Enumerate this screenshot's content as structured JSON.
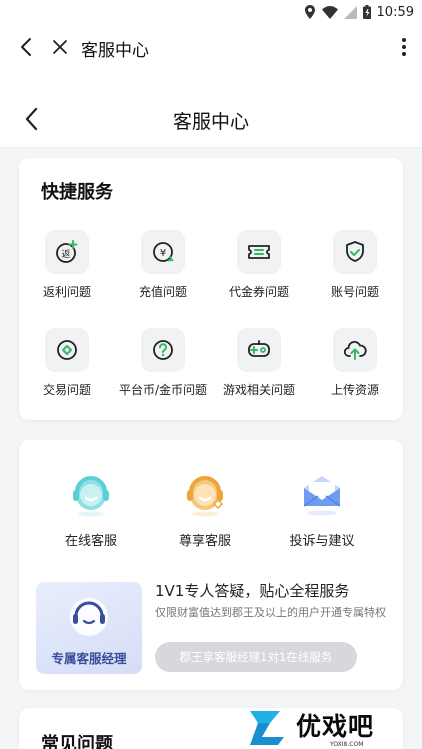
{
  "status_bar": {
    "time": "10:59",
    "icons": [
      "location-icon",
      "wifi-icon",
      "signal-icon",
      "battery-icon"
    ]
  },
  "web_bar": {
    "title": "客服中心"
  },
  "page_header": {
    "title": "客服中心"
  },
  "quick_services": {
    "title": "快捷服务",
    "items": [
      {
        "label": "返利问题",
        "icon": "rebate-icon"
      },
      {
        "label": "充值问题",
        "icon": "recharge-icon"
      },
      {
        "label": "代金券问题",
        "icon": "voucher-icon"
      },
      {
        "label": "账号问题",
        "icon": "account-shield-icon"
      },
      {
        "label": "交易问题",
        "icon": "trade-icon"
      },
      {
        "label": "平台币/金币问题",
        "icon": "coin-question-icon"
      },
      {
        "label": "游戏相关问题",
        "icon": "gamepad-icon"
      },
      {
        "label": "上传资源",
        "icon": "cloud-upload-icon"
      }
    ]
  },
  "contact": {
    "online": {
      "label": "在线客服",
      "icon": "headset-icon"
    },
    "vip": {
      "label": "尊享客服",
      "icon": "vip-headset-icon"
    },
    "complaint": {
      "label": "投诉与建议",
      "icon": "envelope-icon"
    }
  },
  "exclusive": {
    "box_label": "专属客服经理",
    "title": "1V1专人答疑，贴心全程服务",
    "description": "仅限财富值达到郡王及以上的用户开通专属特权",
    "button_label": "郡王享客服经理1对1在线服务"
  },
  "faq": {
    "title": "常见问题"
  },
  "watermark": {
    "text": "优戏吧",
    "sub": "YOXI8.COM"
  },
  "colors": {
    "accent_green": "#34b86a",
    "teal": "#5ccfd6",
    "orange": "#f0a33b",
    "blue": "#4f86ea",
    "vip_blue": "#3a4d9a"
  }
}
